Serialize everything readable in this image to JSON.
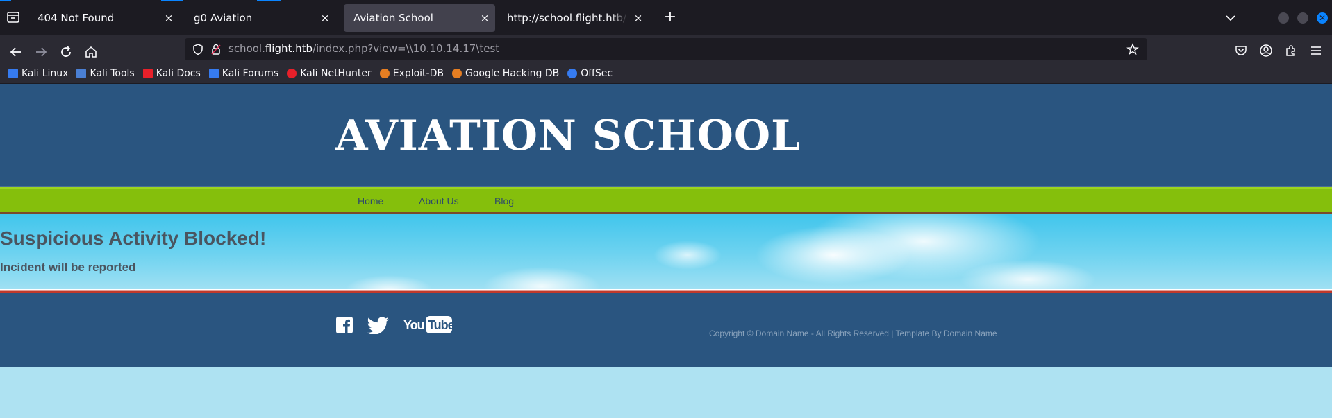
{
  "tabs": [
    {
      "title": "404 Not Found",
      "active": false
    },
    {
      "title": "g0 Aviation",
      "active": false
    },
    {
      "title": "Aviation School",
      "active": true
    },
    {
      "title": "http://school.flight.htb/index",
      "active": false
    }
  ],
  "tab_close_glyph": "×",
  "newtab_glyph": "+",
  "address": {
    "prefix": "school.",
    "domain": "flight.htb",
    "path": "/index.php?view=\\\\10.10.14.17\\test"
  },
  "bookmarks": [
    {
      "label": "Kali Linux",
      "color": "#367bf0"
    },
    {
      "label": "Kali Tools",
      "color": "#c0392b"
    },
    {
      "label": "Kali Docs",
      "color": "#e8202a"
    },
    {
      "label": "Kali Forums",
      "color": "#367bf0"
    },
    {
      "label": "Kali NetHunter",
      "color": "#e8202a"
    },
    {
      "label": "Exploit-DB",
      "color": "#e67e22"
    },
    {
      "label": "Google Hacking DB",
      "color": "#e67e22"
    },
    {
      "label": "OffSec",
      "color": "#367bf0"
    }
  ],
  "site": {
    "title": "AVIATION SCHOOL",
    "nav": [
      "Home",
      "About Us",
      "Blog"
    ],
    "heading": "Suspicious Activity Blocked!",
    "subheading": "Incident will be reported",
    "copyright": "Copyright © Domain Name - All Rights Reserved | Template By Domain Name",
    "youtube_label": "YouTube"
  },
  "colors": {
    "header_blue": "#2a5580",
    "nav_green": "#85bf0c",
    "accent": "#0a84ff"
  }
}
